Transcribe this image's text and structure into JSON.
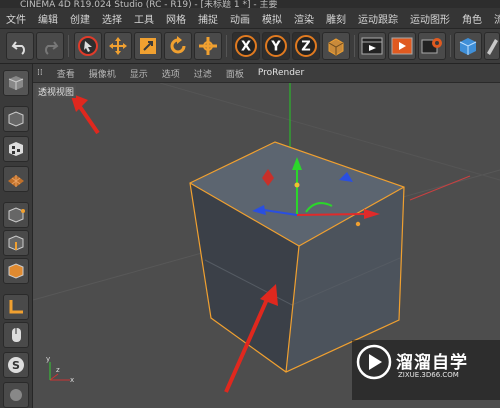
{
  "window": {
    "title": "CINEMA 4D R19.024 Studio (RC - R19) - [未标题 1 *] - 主要"
  },
  "menu": [
    "文件",
    "编辑",
    "创建",
    "选择",
    "工具",
    "网格",
    "捕捉",
    "动画",
    "模拟",
    "渲染",
    "雕刻",
    "运动跟踪",
    "运动图形",
    "角色",
    "流水线"
  ],
  "toolbar": {
    "buttons": [
      "undo-icon",
      "redo-icon",
      "live-selection-icon",
      "move-icon",
      "scale-icon",
      "rotate-icon",
      "transform-icon",
      "x-axis-icon",
      "y-axis-icon",
      "z-axis-icon",
      "world-coordinate-icon",
      "render-view-icon",
      "render-picture-viewer-icon",
      "render-settings-icon",
      "cube-icon",
      "pen-icon"
    ],
    "axis_labels": {
      "x": "X",
      "y": "Y",
      "z": "Z"
    }
  },
  "viewport_menu": [
    "查看",
    "摄像机",
    "显示",
    "选项",
    "过滤",
    "面板",
    "ProRender"
  ],
  "viewport_label": "透视视图",
  "left_tools": [
    "make-editable-icon",
    "texture-mode-icon",
    "workplane-icon",
    "points-mode-icon",
    "edges-mode-icon",
    "polygons-mode-icon",
    "enable-axis-icon",
    "tweak-mode-icon",
    "snapping-icon"
  ],
  "watermark": {
    "name": "溜溜自学",
    "url": "ZIXUE.3D66.COM"
  },
  "colors": {
    "accent_orange": "#f0a030",
    "annotation_red": "#e0281e",
    "axis_green": "#2bd62b",
    "axis_blue": "#2a4fe0"
  }
}
